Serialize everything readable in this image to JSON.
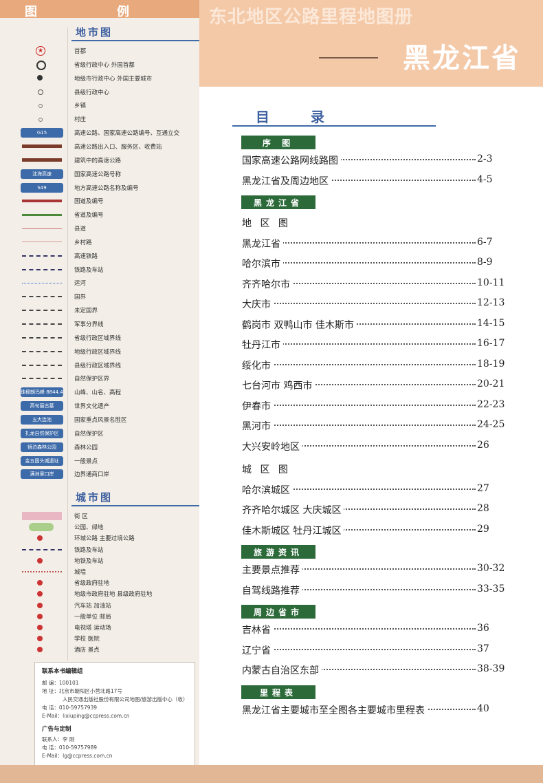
{
  "legend": {
    "title": "图 例",
    "map_section": "地市图",
    "city_section": "城市图",
    "map_items": [
      {
        "label": "首都",
        "icon": "capital-star-icon"
      },
      {
        "label": "省级行政中心 外国首都",
        "icon": "provincial-center-icon"
      },
      {
        "label": "地级市行政中心 外国主要城市",
        "icon": "prefecture-city-icon"
      },
      {
        "label": "县级行政中心",
        "icon": "county-center-icon"
      },
      {
        "label": "乡镇",
        "icon": "township-icon"
      },
      {
        "label": "村庄",
        "icon": "village-icon"
      },
      {
        "label": "高速公路、国家高速公路编号、互通立交",
        "icon": "expressway-icon",
        "badge": "G15"
      },
      {
        "label": "高速公路出入口、服务区、收费站",
        "icon": "expressway-exit-icon"
      },
      {
        "label": "建筑中的高速公路",
        "icon": "expressway-construction-icon"
      },
      {
        "label": "国家高速公路号称",
        "icon": "national-expressway-name-icon",
        "badge": "沈海高速"
      },
      {
        "label": "地方高速公路名称及编号",
        "icon": "local-expressway-icon",
        "badge": "S49"
      },
      {
        "label": "国道及编号",
        "icon": "national-road-icon"
      },
      {
        "label": "省道及编号",
        "icon": "provincial-road-icon"
      },
      {
        "label": "县道",
        "icon": "county-road-icon"
      },
      {
        "label": "乡村路",
        "icon": "rural-road-icon"
      },
      {
        "label": "高速铁路",
        "icon": "high-speed-rail-icon"
      },
      {
        "label": "铁路及车站",
        "icon": "railway-icon"
      },
      {
        "label": "运河",
        "icon": "canal-icon"
      },
      {
        "label": "国界",
        "icon": "national-border-icon"
      },
      {
        "label": "未定国界",
        "icon": "undefined-border-icon"
      },
      {
        "label": "军事分界线",
        "icon": "military-line-icon"
      },
      {
        "label": "省级行政区域界线",
        "icon": "provincial-boundary-icon"
      },
      {
        "label": "地级行政区域界线",
        "icon": "prefecture-boundary-icon"
      },
      {
        "label": "县级行政区域界线",
        "icon": "county-boundary-icon"
      },
      {
        "label": "自然保护区界",
        "icon": "reserve-boundary-icon"
      },
      {
        "label": "山峰、山名、高程",
        "icon": "mountain-peak-icon",
        "badge": "珠穆朗玛峰 8844.43"
      },
      {
        "label": "世界文化遗产",
        "icon": "world-heritage-icon",
        "badge": "高句丽古墓"
      },
      {
        "label": "国家重点风景名胜区",
        "icon": "scenic-area-icon",
        "badge": "五大连池"
      },
      {
        "label": "自然保护区",
        "icon": "nature-reserve-icon",
        "badge": "扎龙自然保护区"
      },
      {
        "label": "森林公园",
        "icon": "forest-park-icon",
        "badge": "镜泊森林公园"
      },
      {
        "label": "一般景点",
        "icon": "attraction-icon",
        "badge": "金五国头城遗址"
      },
      {
        "label": "边界通商口岸",
        "icon": "border-port-icon",
        "badge": "满洲里口岸"
      }
    ],
    "city_items": [
      {
        "label": "街 区",
        "icon": "block-icon"
      },
      {
        "label": "公园、绿地",
        "icon": "park-icon"
      },
      {
        "label": "环城公路 主要过境公路",
        "icon": "ring-road-icon"
      },
      {
        "label": "铁路及车站",
        "icon": "rail-station-icon"
      },
      {
        "label": "地铁及车站",
        "icon": "metro-icon"
      },
      {
        "label": "城墙",
        "icon": "city-wall-icon"
      },
      {
        "label": "省级政府驻地",
        "icon": "provincial-gov-icon"
      },
      {
        "label": "地级市政府驻地 县级政府驻地",
        "icon": "city-gov-icon"
      },
      {
        "label": "汽车站 加油站",
        "icon": "bus-station-icon"
      },
      {
        "label": "一般单位 邮局",
        "icon": "post-office-icon"
      },
      {
        "label": "电视塔 运动场",
        "icon": "tv-tower-icon"
      },
      {
        "label": "学校 医院",
        "icon": "school-icon"
      },
      {
        "label": "酒店 景点",
        "icon": "hotel-icon"
      }
    ]
  },
  "contact": {
    "heading": "联系本书编辑组",
    "lines": [
      "邮 编：100101",
      "地 址：北京市朝阳区小营北路17号",
      "人民交通出版社股份有限公司地图/旅游出版中心（收）",
      "电 话：010-59757939",
      "E-Mail：lixiuping@ccpress.com.cn"
    ],
    "ad_heading": "广告与定制",
    "ad_lines": [
      "联系人：李 刚",
      "电 话：010-59757989",
      "E-Mail：lg@ccpress.com.cn"
    ]
  },
  "header": {
    "series_title": "东北地区公路里程地图册",
    "province_title": "黑龙江省"
  },
  "toc": {
    "title": "目录",
    "sections": [
      {
        "band": "序 图",
        "entries": [
          {
            "name": "国家高速公路网线路图",
            "page": "2-3"
          },
          {
            "name": "黑龙江省及周边地区",
            "page": "4-5"
          }
        ]
      },
      {
        "band": "黑龙江省",
        "entries": []
      },
      {
        "sub": "地 区 图",
        "entries": [
          {
            "name": "黑龙江省",
            "page": "6-7"
          },
          {
            "name": "哈尔滨市",
            "page": "8-9"
          },
          {
            "name": "齐齐哈尔市",
            "page": "10-11"
          },
          {
            "name": "大庆市",
            "page": "12-13"
          },
          {
            "name": "鹤岗市 双鸭山市 佳木斯市",
            "page": "14-15"
          },
          {
            "name": "牡丹江市",
            "page": "16-17"
          },
          {
            "name": "绥化市",
            "page": "18-19"
          },
          {
            "name": "七台河市 鸡西市",
            "page": "20-21"
          },
          {
            "name": "伊春市",
            "page": "22-23"
          },
          {
            "name": "黑河市",
            "page": "24-25"
          },
          {
            "name": "大兴安岭地区",
            "page": "26"
          }
        ]
      },
      {
        "sub": "城 区 图",
        "entries": [
          {
            "name": "哈尔滨城区",
            "page": "27"
          },
          {
            "name": "齐齐哈尔城区 大庆城区",
            "page": "28"
          },
          {
            "name": "佳木斯城区 牡丹江城区",
            "page": "29"
          }
        ]
      },
      {
        "band": "旅游资讯",
        "entries": [
          {
            "name": "主要景点推荐",
            "page": "30-32"
          },
          {
            "name": "自驾线路推荐",
            "page": "33-35"
          }
        ]
      },
      {
        "band": "周边省市",
        "entries": [
          {
            "name": "吉林省",
            "page": "36"
          },
          {
            "name": "辽宁省",
            "page": "37"
          },
          {
            "name": "内蒙古自治区东部",
            "page": "38-39"
          }
        ]
      },
      {
        "band": "里程表",
        "entries": [
          {
            "name": "黑龙江省主要城市至全图各主要城市里程表",
            "page": "40"
          }
        ]
      }
    ]
  },
  "colors": {
    "band": "#2d6a3a",
    "header": "#f4c9a8",
    "accent": "#3d5fa0"
  }
}
